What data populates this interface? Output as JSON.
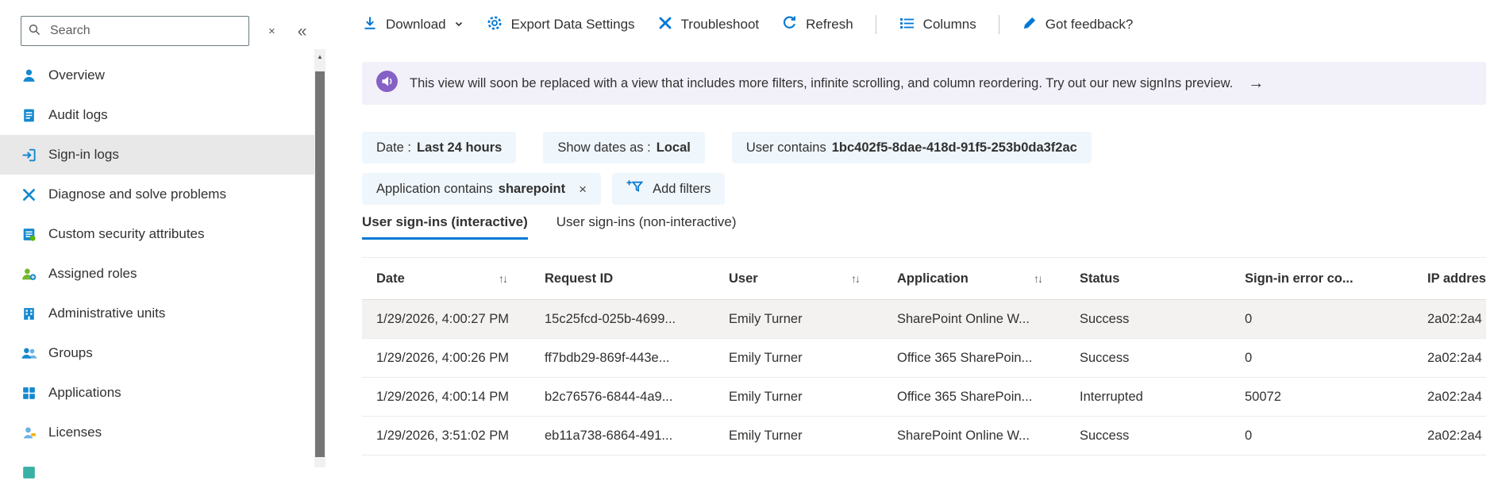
{
  "sidebar": {
    "search_placeholder": "Search",
    "selected_item": "Sign-in logs",
    "items": [
      {
        "label": "Overview"
      },
      {
        "label": "Audit logs"
      },
      {
        "label": "Sign-in logs"
      },
      {
        "label": "Diagnose and solve problems"
      },
      {
        "label": "Custom security attributes"
      },
      {
        "label": "Assigned roles"
      },
      {
        "label": "Administrative units"
      },
      {
        "label": "Groups"
      },
      {
        "label": "Applications"
      },
      {
        "label": "Licenses"
      }
    ]
  },
  "toolbar": {
    "download_label": "Download",
    "export_label": "Export Data Settings",
    "troubleshoot_label": "Troubleshoot",
    "refresh_label": "Refresh",
    "columns_label": "Columns",
    "feedback_label": "Got feedback?"
  },
  "banner": {
    "text": "This view will soon be replaced with a view that includes more filters, infinite scrolling, and column reordering. Try out our new signIns preview."
  },
  "filters": {
    "pills": [
      {
        "label": "Date :",
        "value": "Last 24 hours"
      },
      {
        "label": "Show dates as :",
        "value": "Local"
      },
      {
        "label": "User contains",
        "value": "1bc402f5-8dae-418d-91f5-253b0da3f2ac"
      },
      {
        "label": "Application contains",
        "value": "sharepoint"
      }
    ],
    "add_filters_label": "Add filters"
  },
  "tabs": [
    {
      "label": "User sign-ins (interactive)",
      "active": true
    },
    {
      "label": "User sign-ins (non-interactive)",
      "active": false
    }
  ],
  "table": {
    "columns": [
      {
        "label": "Date",
        "sortable": true
      },
      {
        "label": "Request ID",
        "sortable": false
      },
      {
        "label": "User",
        "sortable": true
      },
      {
        "label": "Application",
        "sortable": true
      },
      {
        "label": "Status",
        "sortable": false
      },
      {
        "label": "Sign-in error co...",
        "sortable": false
      },
      {
        "label": "IP addres...",
        "sortable": false
      }
    ],
    "rows": [
      [
        "1/29/2026, 4:00:27 PM",
        "15c25fcd-025b-4699...",
        "Emily Turner",
        "SharePoint Online W...",
        "Success",
        "0",
        "2a02:2a4"
      ],
      [
        "1/29/2026, 4:00:26 PM",
        "ff7bdb29-869f-443e...",
        "Emily Turner",
        "Office 365 SharePoin...",
        "Success",
        "0",
        "2a02:2a4"
      ],
      [
        "1/29/2026, 4:00:14 PM",
        "b2c76576-6844-4a9...",
        "Emily Turner",
        "Office 365 SharePoin...",
        "Interrupted",
        "50072",
        "2a02:2a4"
      ],
      [
        "1/29/2026, 3:51:02 PM",
        "eb11a738-6864-491...",
        "Emily Turner",
        "SharePoint Online W...",
        "Success",
        "0",
        "2a02:2a4"
      ]
    ]
  },
  "icons": {
    "sort": "↑↓",
    "close": "×",
    "clear": "×",
    "collapse": "«",
    "arrow_right": "→",
    "scroll_up": "▲"
  },
  "colors": {
    "accent": "#0078d4",
    "pill_bg": "#eff6fc",
    "banner_bg": "#f2f1fa",
    "banner_icon": "#8661c5",
    "selected_row_bg": "#f3f2f1",
    "selected_nav_bg": "#e8e8e8"
  }
}
